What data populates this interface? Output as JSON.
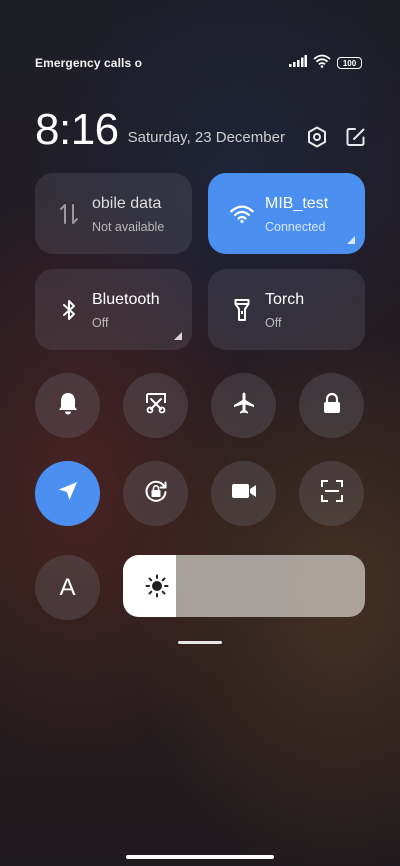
{
  "status_bar": {
    "left_text": "Emergency calls o",
    "battery_level": "100",
    "icons": [
      "signal-icon",
      "wifi-icon",
      "battery-icon"
    ]
  },
  "header": {
    "time": "8:16",
    "date": "Saturday, 23 December",
    "icons": [
      "settings-icon",
      "edit-icon"
    ]
  },
  "tiles": [
    {
      "title": "obile data",
      "subtitle": "Not available",
      "icon": "mobile-data-icon",
      "state": "disabled"
    },
    {
      "title": "MIB_test",
      "subtitle": "Connected",
      "icon": "wifi-icon",
      "state": "active"
    },
    {
      "title": "Bluetooth",
      "subtitle": "Off",
      "icon": "bluetooth-icon",
      "state": "off"
    },
    {
      "title": "Torch",
      "subtitle": "Off",
      "icon": "torch-icon",
      "state": "off"
    }
  ],
  "toggles_row1": [
    "bell-icon",
    "screenshot-icon",
    "airplane-icon",
    "lock-icon"
  ],
  "toggles_row2": [
    "location-icon",
    "rotation-lock-icon",
    "video-camera-icon",
    "scanner-icon"
  ],
  "font_button": {
    "label": "A"
  },
  "brightness": {
    "level_percent": 22,
    "icon": "brightness-icon"
  },
  "colors": {
    "accent": "#4b8ff1"
  }
}
